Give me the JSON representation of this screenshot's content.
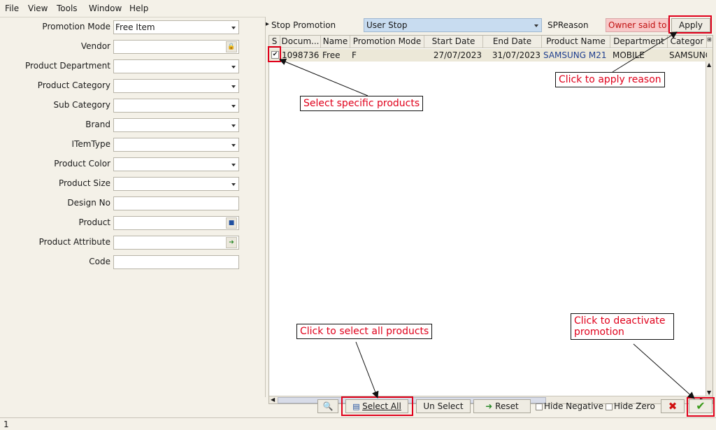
{
  "menu": [
    "File",
    "View",
    "Tools",
    "Window",
    "Help"
  ],
  "filters": [
    {
      "label": "Promotion Mode",
      "value": "Free Item",
      "kind": "dropdown"
    },
    {
      "label": "Vendor",
      "value": "",
      "kind": "lookup"
    },
    {
      "label": "Product Department",
      "value": "",
      "kind": "dropdown"
    },
    {
      "label": "Product Category",
      "value": "",
      "kind": "dropdown"
    },
    {
      "label": "Sub Category",
      "value": "",
      "kind": "dropdown"
    },
    {
      "label": "Brand",
      "value": "",
      "kind": "dropdown"
    },
    {
      "label": "ITemType",
      "value": "",
      "kind": "dropdown"
    },
    {
      "label": "Product Color",
      "value": "",
      "kind": "dropdown"
    },
    {
      "label": "Product Size",
      "value": "",
      "kind": "dropdown"
    },
    {
      "label": "Design No",
      "value": "",
      "kind": "text"
    },
    {
      "label": "Product",
      "value": "",
      "kind": "lookup"
    },
    {
      "label": "Product Attribute",
      "value": "",
      "kind": "lookup-green"
    },
    {
      "label": "Code",
      "value": "",
      "kind": "text"
    }
  ],
  "stop_bar": {
    "label": "Stop Promotion",
    "value": "User Stop",
    "reason_label": "SPReason",
    "reason_value": "Owner said to",
    "apply_label": "Apply"
  },
  "grid": {
    "headers": [
      "S",
      "Docum...",
      "Name",
      "Promotion Mode",
      "Start Date",
      "End Date",
      "Product Name",
      "Department",
      "Categor"
    ],
    "rows": [
      [
        "✔",
        "1098736",
        "Free",
        "F",
        "27/07/2023",
        "31/07/2023",
        "SAMSUNG M21",
        "MOBILE",
        "SAMSUNG"
      ]
    ]
  },
  "toolbar": {
    "select_all": "Select All",
    "unselect": "Un Select",
    "reset": "Reset",
    "hide_negative": "Hide Negative",
    "hide_zero": "Hide Zero"
  },
  "status": {
    "text": "1"
  },
  "callouts": {
    "select_specific": "Select specific products",
    "apply_reason": "Click to apply reason",
    "select_all": "Click to select all products",
    "deactivate": "Click to deactivate promotion"
  },
  "icons": {
    "preview": "magnifier-icon",
    "cancel": "red-x-icon",
    "confirm": "green-check-icon",
    "reset": "green-arrow-icon"
  },
  "colors": {
    "accent_red": "#e0001b",
    "stop_value_bg": "#c8dcf0",
    "reason_bg": "#f8c8c8"
  }
}
